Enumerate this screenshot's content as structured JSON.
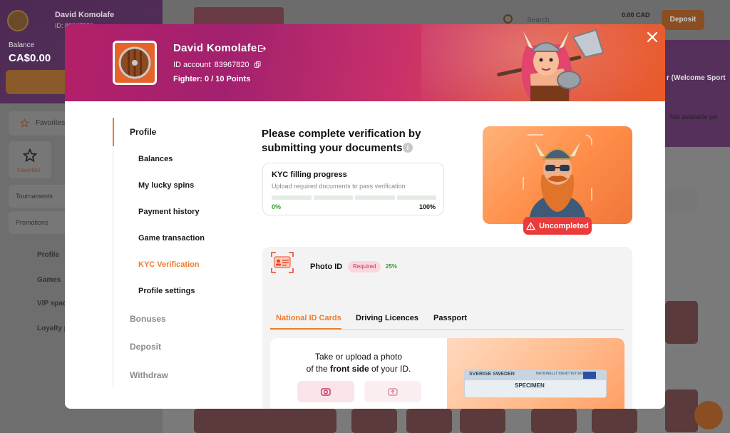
{
  "background": {
    "user": {
      "name": "David Komolafe",
      "id": "ID: 83967820"
    },
    "balance": {
      "label": "Balance",
      "value": "CA$0.00"
    },
    "sidebar": {
      "favorites": "Favorites",
      "favorites_tile": "Favorites",
      "tournaments": "Tournaments",
      "promotions": "Promotions",
      "nav": [
        "Profile",
        "Games",
        "VIP spac",
        "Loyalty p"
      ]
    },
    "header": {
      "search": "Search",
      "balance": "0.00 CAD",
      "deposit": "Deposit"
    },
    "right_panel": {
      "bonus_title": "r (Welcome Sport",
      "availability": "Not available yet"
    }
  },
  "modal": {
    "profile": {
      "name": "David Komolafe",
      "id_label": "ID account",
      "id_value": "83967820",
      "fighter": "Fighter: 0  / 10 Points"
    },
    "nav": {
      "profile": "Profile",
      "items": [
        "Balances",
        "My lucky spins",
        "Payment history",
        "Game transaction",
        "KYC Verification",
        "Profile settings"
      ],
      "bonuses": "Bonuses",
      "deposit": "Deposit",
      "withdraw": "Withdraw"
    },
    "headline": "Please complete verification by submitting your documents",
    "kyc": {
      "title": "KYC filling progress",
      "subtitle": "Upload required documents to pass verification",
      "min_label": "0%",
      "max_label": "100%",
      "progress": 0
    },
    "status_badge": "Uncompleted",
    "document": {
      "title": "Photo ID",
      "required": "Required",
      "percent": "25%",
      "tabs": [
        "National ID Cards",
        "Driving Licences",
        "Passport"
      ],
      "upload_line1": "Take or upload a photo",
      "upload_line2_pre": "of the ",
      "upload_line2_bold": "front side",
      "upload_line2_post": " of your ID.",
      "id_preview": {
        "country": "SVERIGE  SWEDEN",
        "heading": "NATIONELLT IDENTITETSKORT",
        "specimen": "SPECIMEN"
      }
    }
  },
  "colors": {
    "accent": "#f07a2a",
    "success": "#4bb34b",
    "danger": "#ea3a3a"
  }
}
